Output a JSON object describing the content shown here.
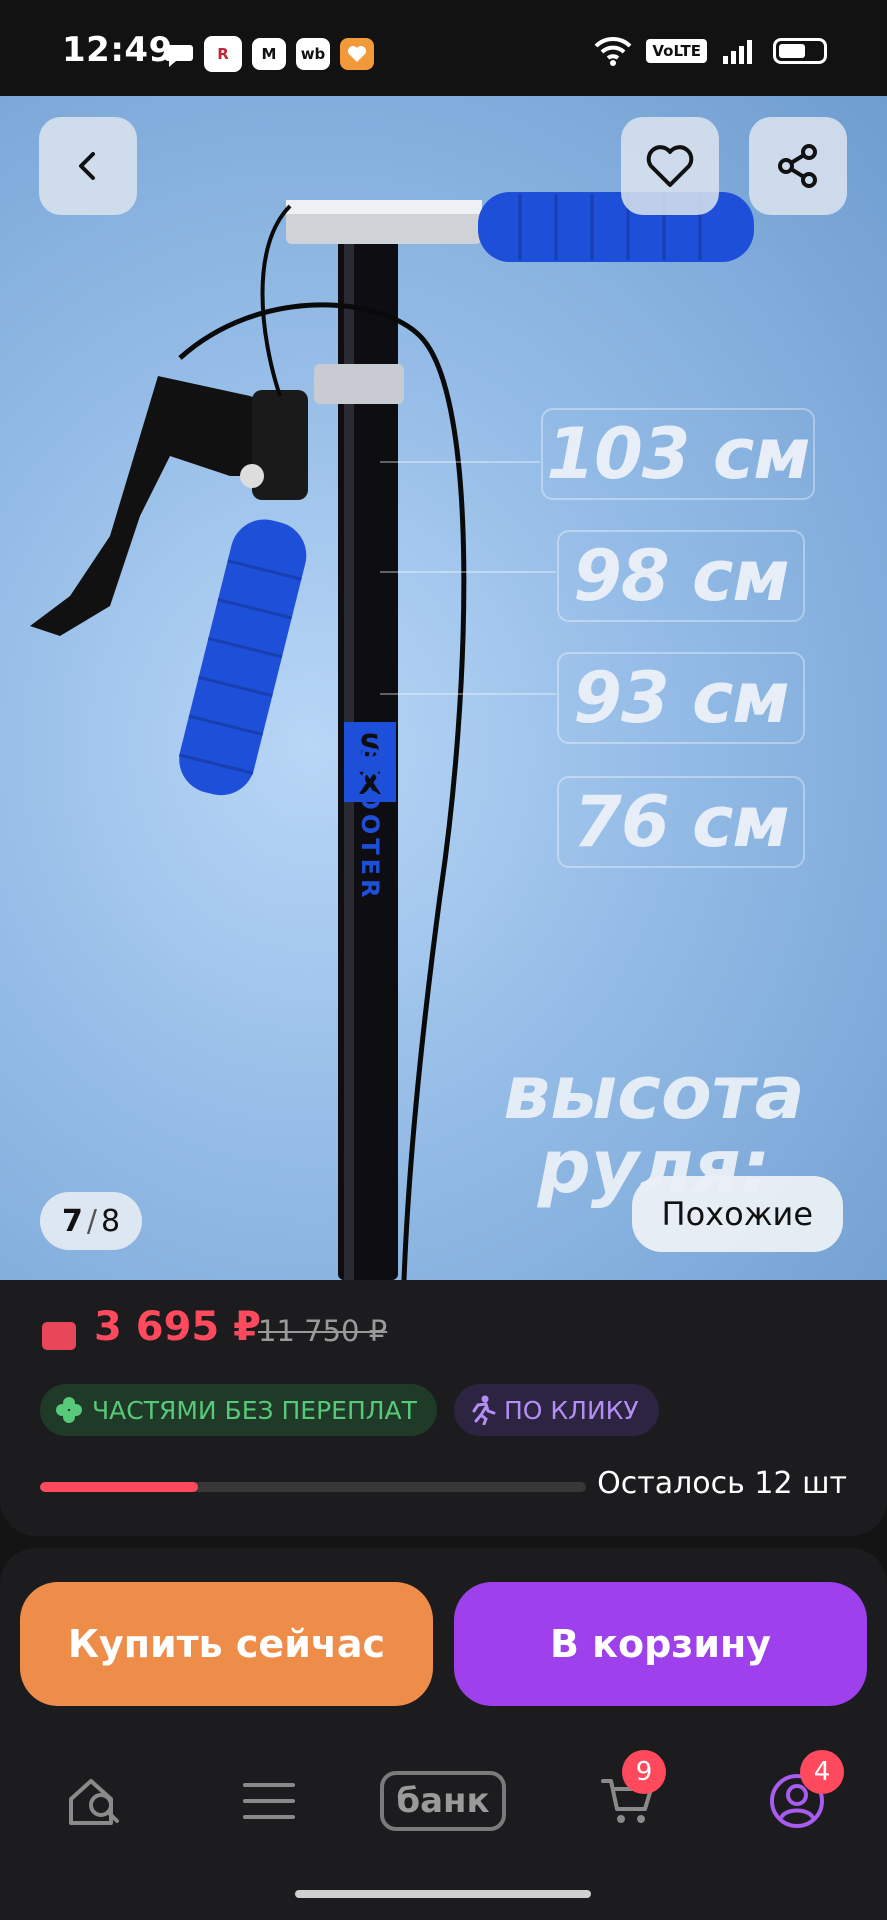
{
  "status_bar": {
    "time": "12:49",
    "network": "VoLTE",
    "icons": [
      "chat-icon",
      "app-icon-r",
      "app-icon-m",
      "app-icon-wb",
      "app-icon-heart",
      "wifi-icon",
      "signal-icon",
      "battery-icon"
    ],
    "app_labels": {
      "wb": "wb"
    }
  },
  "gallery": {
    "current": "7",
    "separator": "/",
    "total": "8",
    "similar_label": "Похожие",
    "sizes": [
      "103 см",
      "98 см",
      "93 см",
      "76 см"
    ],
    "caption_line1": "высота",
    "caption_line2": "руля:",
    "brand_text": "SX SCOOTER"
  },
  "price": {
    "current": "3 695 ₽",
    "old": "11 750 ₽",
    "accent_color": "#ff4a5e"
  },
  "chips": {
    "installments": "ЧАСТЯМИ БЕЗ ПЕРЕПЛАТ",
    "one_click": "ПО КЛИКУ"
  },
  "stock": {
    "remaining_label": "Осталось 12 шт",
    "progress_fraction": 0.29
  },
  "actions": {
    "buy_now": "Купить сейчас",
    "add_to_cart": "В корзину"
  },
  "nav": {
    "bank_label": "банк",
    "cart_badge": "9",
    "profile_badge": "4"
  }
}
